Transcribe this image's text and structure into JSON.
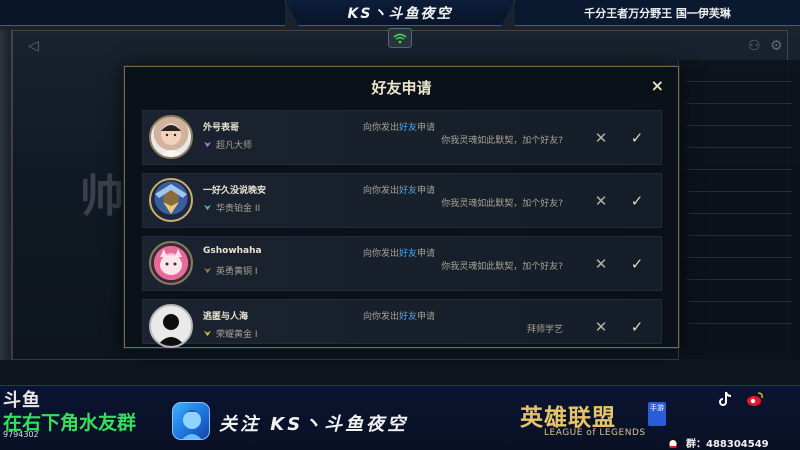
{
  "stream": {
    "banner_title": "KS丶斗鱼夜空",
    "top_right_text": "千分王者万分野王  国一伊芙琳",
    "douyu_logo": "斗鱼",
    "room_id": "9794302",
    "marquee_text": "在右下角水友群",
    "follow_text": "关注  KS丶斗鱼夜空",
    "game_logo_cn": "英雄联盟",
    "game_logo_en": "LEAGUE of LEGENDS",
    "game_badge": "手游",
    "group_label": "群：488304549"
  },
  "modal": {
    "title": "好友申请",
    "close_symbol": "×",
    "requests": [
      {
        "name": "外号表哥",
        "rank": "超凡大师",
        "verb_prefix": "向你发出",
        "verb_highlight": "好友",
        "verb_suffix": "申请",
        "message": "你我灵魂如此默契，加个好友?",
        "decline": "✕",
        "accept": "✓"
      },
      {
        "name": "一好久没说晚安",
        "rank": "华贵铂金 II",
        "verb_prefix": "向你发出",
        "verb_highlight": "好友",
        "verb_suffix": "申请",
        "message": "你我灵魂如此默契，加个好友?",
        "decline": "✕",
        "accept": "✓"
      },
      {
        "name": "Gshowhaha",
        "rank": "英勇黄铜 I",
        "verb_prefix": "向你发出",
        "verb_highlight": "好友",
        "verb_suffix": "申请",
        "message": "你我灵魂如此默契，加个好友?",
        "decline": "✕",
        "accept": "✓"
      },
      {
        "name": "逃匿与人海",
        "rank": "荣耀黄金 I",
        "verb_prefix": "向你发出",
        "verb_highlight": "好友",
        "verb_suffix": "申请",
        "message": "拜师学艺",
        "decline": "✕",
        "accept": "✓"
      }
    ]
  },
  "colors": {
    "accent_gold": "#c8aa6e",
    "link_blue": "#4ea7e6",
    "marquee_green": "#35e05a"
  }
}
